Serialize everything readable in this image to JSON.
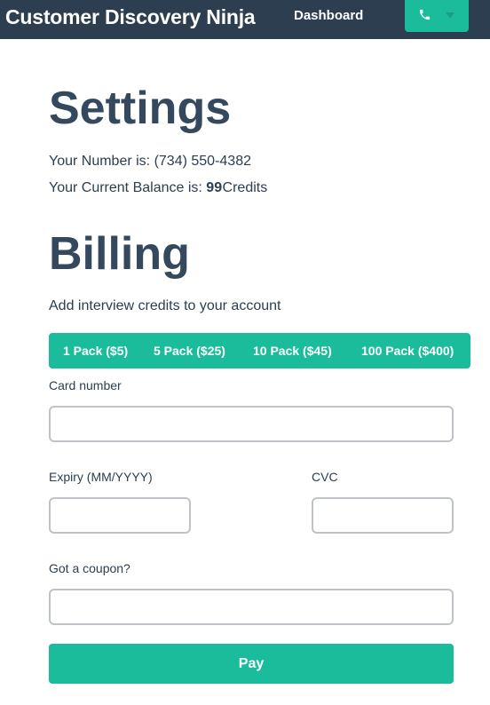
{
  "navbar": {
    "brand": "Customer Discovery Ninja",
    "dashboard_link": "Dashboard",
    "phone_icon": "phone-icon",
    "dropdown_icon": "caret-down-icon",
    "accent_color": "#1abc9c",
    "background_color": "#2c3e50"
  },
  "settings": {
    "title": "Settings",
    "number_label": "Your Number is:",
    "number_value": "(734) 550-4382",
    "balance_label": "Your Current Balance is:",
    "balance_value": "99",
    "balance_unit": "Credits"
  },
  "billing": {
    "title": "Billing",
    "subtitle": "Add interview credits to your account",
    "packs": [
      {
        "label": "1 Pack ($5)"
      },
      {
        "label": "5 Pack ($25)"
      },
      {
        "label": "10 Pack ($45)"
      },
      {
        "label": "100 Pack ($400)"
      }
    ],
    "card_number_label": "Card number",
    "card_number_value": "",
    "expiry_label": "Expiry (MM/YYYY)",
    "expiry_value": "",
    "cvc_label": "CVC",
    "cvc_value": "",
    "coupon_label": "Got a coupon?",
    "coupon_value": "",
    "pay_label": "Pay"
  }
}
